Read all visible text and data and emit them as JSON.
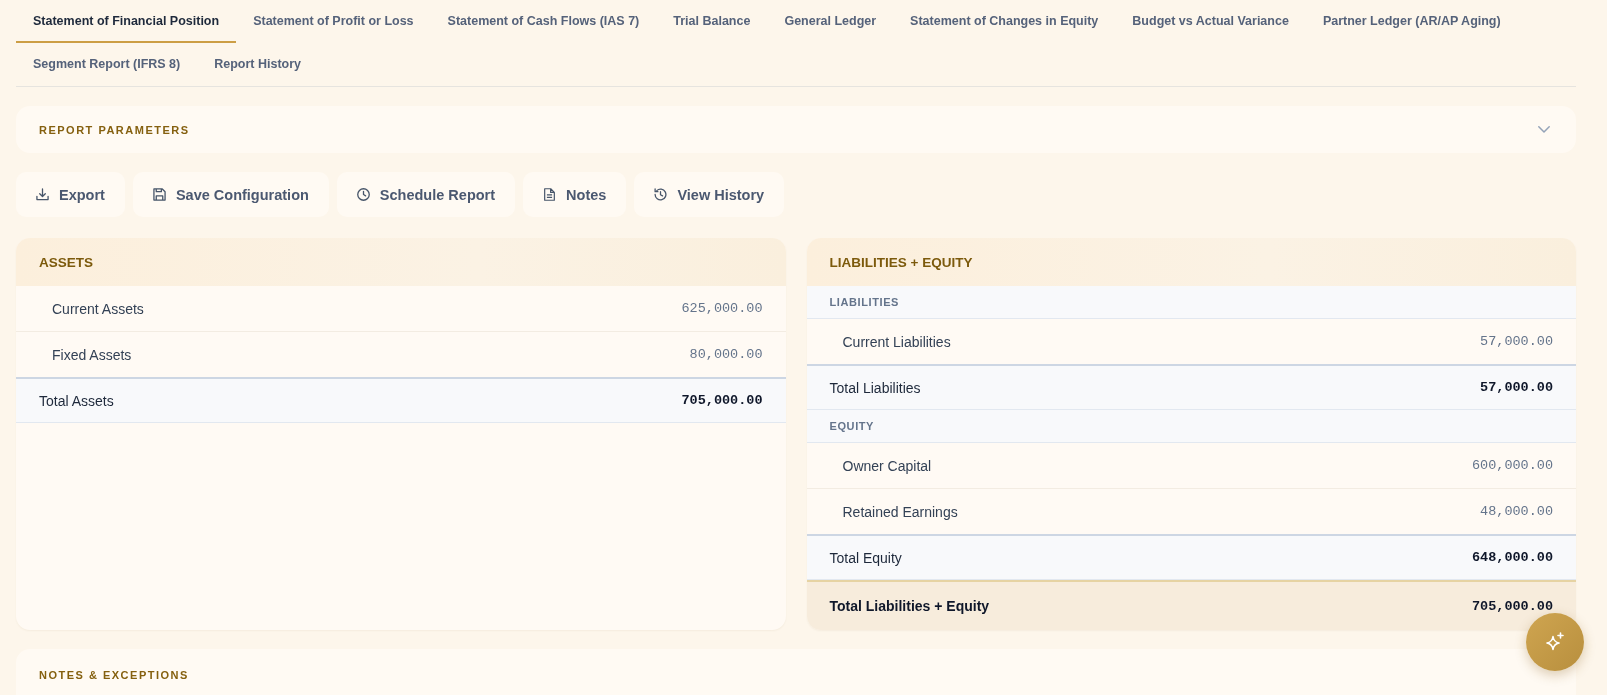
{
  "tabs": [
    {
      "label": "Statement of Financial Position",
      "selected": true
    },
    {
      "label": "Statement of Profit or Loss",
      "selected": false
    },
    {
      "label": "Statement of Cash Flows (IAS 7)",
      "selected": false
    },
    {
      "label": "Trial Balance",
      "selected": false
    },
    {
      "label": "General Ledger",
      "selected": false
    },
    {
      "label": "Statement of Changes in Equity",
      "selected": false
    },
    {
      "label": "Budget vs Actual Variance",
      "selected": false
    },
    {
      "label": "Partner Ledger (AR/AP Aging)",
      "selected": false
    },
    {
      "label": "Segment Report (IFRS 8)",
      "selected": false
    },
    {
      "label": "Report History",
      "selected": false
    }
  ],
  "report_parameters": {
    "title": "REPORT PARAMETERS",
    "expanded": false
  },
  "actions": [
    {
      "kind": "export",
      "label": "Export"
    },
    {
      "kind": "save",
      "label": "Save Configuration"
    },
    {
      "kind": "schedule",
      "label": "Schedule Report"
    },
    {
      "kind": "notes",
      "label": "Notes"
    },
    {
      "kind": "history",
      "label": "View History"
    }
  ],
  "statements": [
    {
      "title": "ASSETS",
      "rows": [
        {
          "kind": "item",
          "label": "Current Assets",
          "amount": "625,000.00"
        },
        {
          "kind": "item",
          "label": "Fixed Assets",
          "amount": "80,000.00"
        },
        {
          "kind": "total",
          "label": "Total Assets",
          "amount": "705,000.00"
        }
      ]
    },
    {
      "title": "LIABILITIES + EQUITY",
      "rows": [
        {
          "kind": "section",
          "label": "LIABILITIES"
        },
        {
          "kind": "item",
          "label": "Current Liabilities",
          "amount": "57,000.00"
        },
        {
          "kind": "total",
          "label": "Total Liabilities",
          "amount": "57,000.00"
        },
        {
          "kind": "section",
          "label": "EQUITY"
        },
        {
          "kind": "item",
          "label": "Owner Capital",
          "amount": "600,000.00"
        },
        {
          "kind": "item",
          "label": "Retained Earnings",
          "amount": "48,000.00"
        },
        {
          "kind": "total",
          "label": "Total Equity",
          "amount": "648,000.00"
        },
        {
          "kind": "grand_total",
          "label": "Total Liabilities + Equity",
          "amount": "705,000.00"
        }
      ]
    }
  ],
  "notes_exceptions": {
    "title": "NOTES & EXCEPTIONS"
  }
}
